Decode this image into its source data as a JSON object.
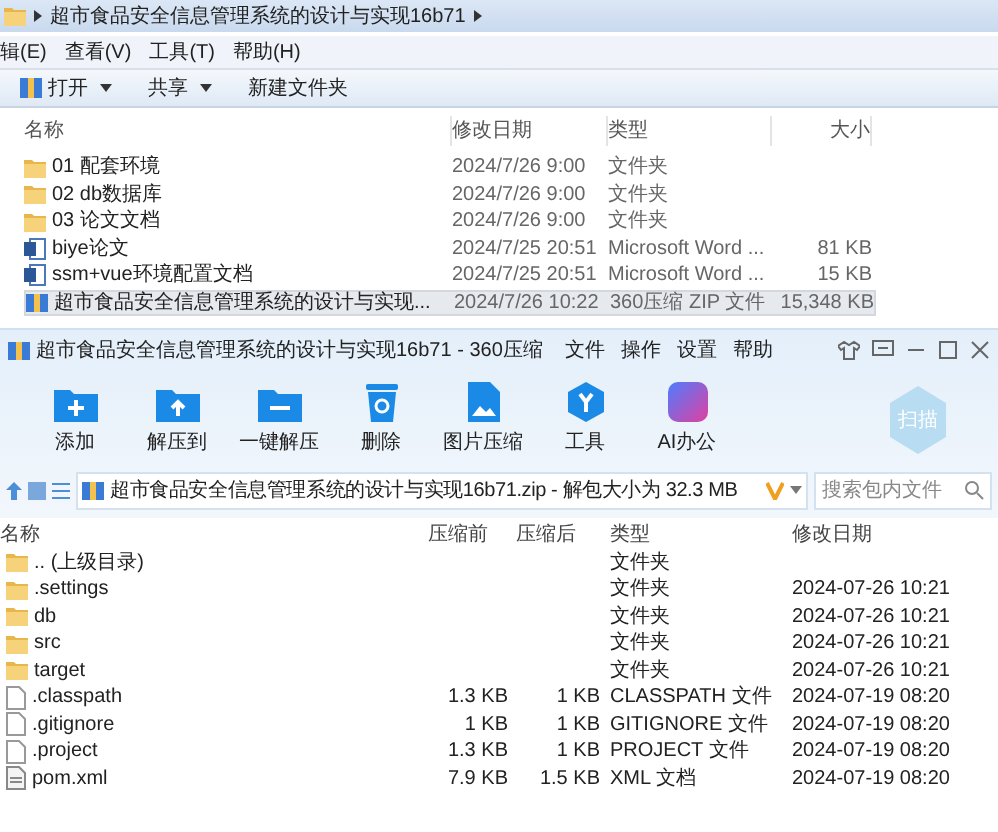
{
  "explorer": {
    "breadcrumb": "超市食品安全信息管理系统的设计与实现16b71",
    "menu": [
      "辑(E)",
      "查看(V)",
      "工具(T)",
      "帮助(H)"
    ],
    "toolbar": [
      {
        "label": "打开",
        "kind": "open",
        "dropdown": true
      },
      {
        "label": "共享",
        "kind": "plain",
        "dropdown": true
      },
      {
        "label": "新建文件夹",
        "kind": "plain",
        "dropdown": false
      }
    ],
    "columns": [
      "名称",
      "修改日期",
      "类型",
      "大小"
    ],
    "files": [
      {
        "kind": "folder",
        "name": "01 配套环境",
        "date": "2024/7/26 9:00",
        "type": "文件夹",
        "selected": false
      },
      {
        "kind": "folder",
        "name": "02 db数据库",
        "date": "2024/7/26 9:00",
        "type": "文件夹",
        "selected": false
      },
      {
        "kind": "folder",
        "name": "03 论文文档",
        "date": "2024/7/26 9:00",
        "type": "文件夹",
        "selected": false
      },
      {
        "kind": "word",
        "name": "biye论文",
        "date": "2024/7/25 20:51",
        "type": "Microsoft Word ...",
        "size": "81 KB",
        "selected": false
      },
      {
        "kind": "word",
        "name": "ssm+vue环境配置文档",
        "date": "2024/7/25 20:51",
        "type": "Microsoft Word ...",
        "size": "15 KB",
        "selected": false
      },
      {
        "kind": "zip",
        "name": "超市食品安全信息管理系统的设计与实现...",
        "date": "2024/7/26 10:22",
        "type": "360压缩 ZIP 文件",
        "size": "15,348 KB",
        "selected": true
      }
    ]
  },
  "zip_window": {
    "title": "超市食品安全信息管理系统的设计与实现16b71 - 360压缩",
    "menu": [
      "文件",
      "操作",
      "设置",
      "帮助"
    ],
    "tools": [
      {
        "kind": "add",
        "label": "添加"
      },
      {
        "kind": "extract",
        "label": "解压到"
      },
      {
        "kind": "oneclick",
        "label": "一键解压"
      },
      {
        "kind": "delete",
        "label": "删除"
      },
      {
        "kind": "image",
        "label": "图片压缩"
      },
      {
        "kind": "tools",
        "label": "工具"
      },
      {
        "kind": "ai",
        "label": "AI办公"
      }
    ],
    "scan_button": "扫描",
    "address": "超市食品安全信息管理系统的设计与实现16b71.zip - 解包大小为 32.3 MB",
    "search": {
      "placeholder": "搜索包内文件"
    },
    "columns": [
      "名称",
      "压缩前",
      "压缩后",
      "类型",
      "修改日期"
    ],
    "files": [
      {
        "kind": "folder",
        "name": ".. (上级目录)",
        "type": "文件夹"
      },
      {
        "kind": "folder",
        "name": ".settings",
        "type": "文件夹",
        "date": "2024-07-26 10:21"
      },
      {
        "kind": "folder",
        "name": "db",
        "type": "文件夹",
        "date": "2024-07-26 10:21"
      },
      {
        "kind": "folder",
        "name": "src",
        "type": "文件夹",
        "date": "2024-07-26 10:21"
      },
      {
        "kind": "folder",
        "name": "target",
        "type": "文件夹",
        "date": "2024-07-26 10:21"
      },
      {
        "kind": "file",
        "name": ".classpath",
        "before": "1.3 KB",
        "after": "1 KB",
        "type": "CLASSPATH 文件",
        "date": "2024-07-19 08:20"
      },
      {
        "kind": "file",
        "name": ".gitignore",
        "before": "1 KB",
        "after": "1 KB",
        "type": "GITIGNORE 文件",
        "date": "2024-07-19 08:20"
      },
      {
        "kind": "file",
        "name": ".project",
        "before": "1.3 KB",
        "after": "1 KB",
        "type": "PROJECT 文件",
        "date": "2024-07-19 08:20"
      },
      {
        "kind": "xml",
        "name": "pom.xml",
        "before": "7.9 KB",
        "after": "1.5 KB",
        "type": "XML 文档",
        "date": "2024-07-19 08:20"
      }
    ]
  }
}
